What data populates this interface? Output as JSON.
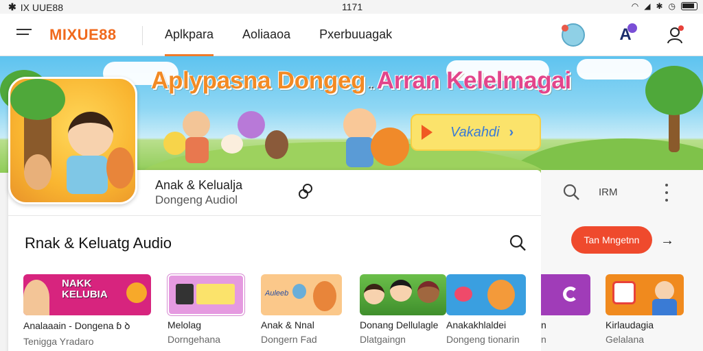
{
  "status": {
    "left": "IX UUE88",
    "center": "1171",
    "colors": {
      "bar": "#f4f4f4"
    }
  },
  "header": {
    "logo": "MIXUE88",
    "nav": [
      {
        "label": "Aplkpara",
        "active": true
      },
      {
        "label": "Aoliaaoa",
        "active": false
      },
      {
        "label": "Pxerbuuagak",
        "active": false
      }
    ],
    "font_icon_letter": "A",
    "accent": "#f07b2a"
  },
  "banner": {
    "title_part1": "Aplypasna Dongeg",
    "title_sep": " .. ",
    "title_part2": "Arran Kelelmagai",
    "listen_label": "Vakahdi",
    "listen_chevron": "›"
  },
  "now_playing": {
    "title": "Anak & Kelualja",
    "subtitle": "Dongeng Audiol"
  },
  "section": {
    "title": "Rnak & Keluatg Audio"
  },
  "right_panel": {
    "label": "IRM",
    "cta_label": "Tan Mngetnn",
    "cta_arrow": "→"
  },
  "cards": [
    {
      "thumb_text": "NAKK KELUBIA",
      "title": "Analaaain  - Dongena ɓ ꝺ",
      "subtitle": "Tenigga Yradaro"
    },
    {
      "thumb_text": "",
      "title": "Melolag",
      "subtitle": "Dorngehana"
    },
    {
      "thumb_text": "Auleeb",
      "title": "Anak & Nnal",
      "subtitle": "Dongern Fad"
    },
    {
      "thumb_text": "",
      "title": "Donang Dellulagle",
      "subtitle": "Dlatgaingn"
    },
    {
      "thumb_text": "",
      "title": "Anakakhlaldei",
      "subtitle": "Dongeng tionarin"
    },
    {
      "thumb_text": "",
      "title": "n",
      "subtitle": "n"
    },
    {
      "thumb_text": "",
      "title": "Kirlaudagia",
      "subtitle": "Gelalana"
    }
  ]
}
